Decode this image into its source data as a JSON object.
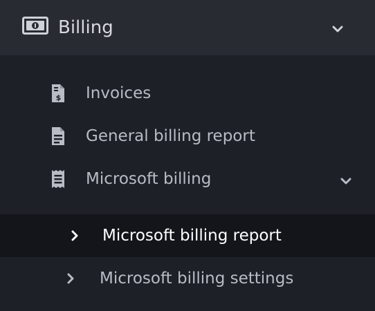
{
  "menu": {
    "billing": {
      "label": "Billing",
      "icon": "money-bill-icon",
      "expanded": true
    },
    "items": [
      {
        "label": "Invoices",
        "icon": "invoice-dollar-icon"
      },
      {
        "label": "General billing report",
        "icon": "file-report-icon"
      },
      {
        "label": "Microsoft billing",
        "icon": "receipt-icon",
        "expanded": true
      }
    ],
    "microsoft": [
      {
        "label": "Microsoft billing report",
        "active": true
      },
      {
        "label": "Microsoft billing settings",
        "active": false
      }
    ]
  },
  "colors": {
    "background": "#1e2027",
    "header_background": "#292b33",
    "active_background": "#14151a",
    "text": "#b9bcc4",
    "active_text": "#ffffff"
  }
}
